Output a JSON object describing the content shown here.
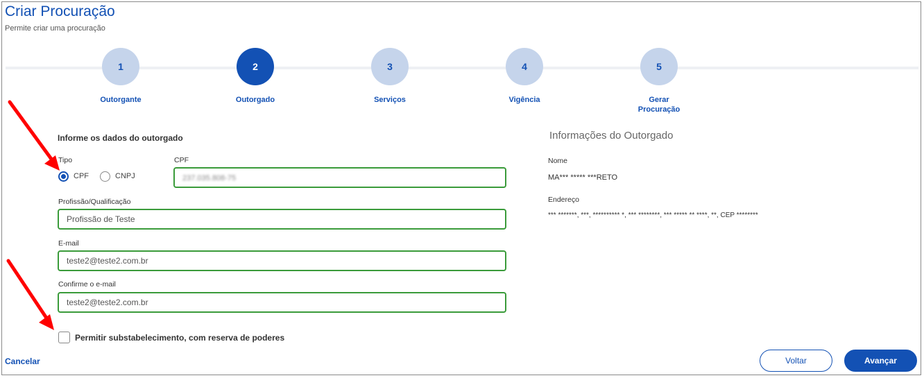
{
  "header": {
    "title": "Criar Procuração",
    "subtitle": "Permite criar uma procuração"
  },
  "stepper": {
    "active_step": 2,
    "steps": [
      {
        "number": "1",
        "label": "Outorgante"
      },
      {
        "number": "2",
        "label": "Outorgado"
      },
      {
        "number": "3",
        "label": "Serviços"
      },
      {
        "number": "4",
        "label": "Vigência"
      },
      {
        "number": "5",
        "label": "Gerar\nProcuração"
      }
    ]
  },
  "form": {
    "section_title": "Informe os dados do outorgado",
    "tipo_label": "Tipo",
    "tipo_options": [
      {
        "label": "CPF",
        "selected": true
      },
      {
        "label": "CNPJ",
        "selected": false
      }
    ],
    "cpf_label": "CPF",
    "cpf_value": "237.035.808-75",
    "profissao_label": "Profissão/Qualificação",
    "profissao_value": "Profissão de Teste",
    "email_label": "E-mail",
    "email_value": "teste2@teste2.com.br",
    "confirm_email_label": "Confirme o e-mail",
    "confirm_email_value": "teste2@teste2.com.br",
    "substabelecimento_label": "Permitir substabelecimento, com reserva de poderes",
    "substabelecimento_checked": false
  },
  "info": {
    "title": "Informações do Outorgado",
    "nome_label": "Nome",
    "nome_value": "MA*** ***** ***RETO",
    "endereco_label": "Endereço",
    "endereco_value": "*** *******, ***, ********** *, *** ********, *** ***** ** ****, **, CEP ********"
  },
  "footer": {
    "cancel_label": "Cancelar",
    "back_label": "Voltar",
    "next_label": "Avançar"
  },
  "colors": {
    "primary": "#1351b4",
    "step_inactive": "#c5d4eb",
    "valid_border": "#3a9b3a",
    "annotation_arrow": "#ff0000"
  }
}
